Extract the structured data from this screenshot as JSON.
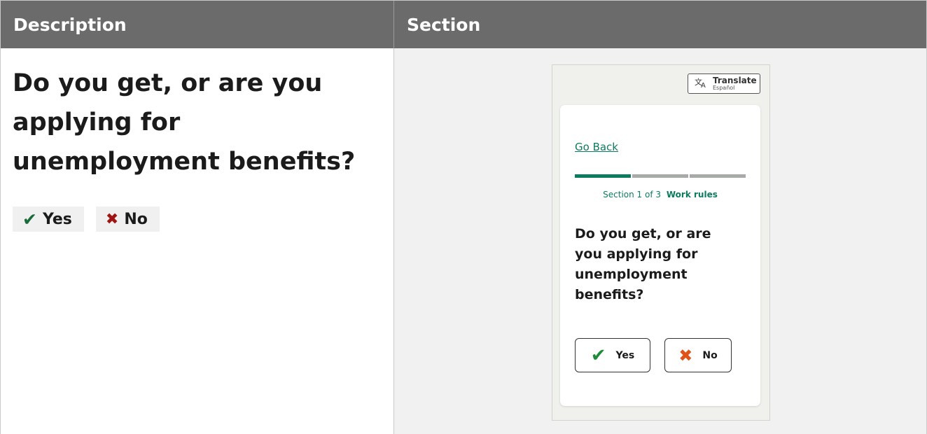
{
  "table": {
    "headers": [
      "Description",
      "Section"
    ]
  },
  "description": {
    "title": "Do you get, or are you applying for unemployment benefits?",
    "yes_label": "Yes",
    "no_label": "No",
    "yes_icon": "heavy-check-icon",
    "no_icon": "heavy-x-icon"
  },
  "preview": {
    "translate": {
      "label": "Translate",
      "sub_label": "Español",
      "icon": "translate-icon"
    },
    "go_back": "Go Back",
    "progress": {
      "current": 1,
      "total": 3
    },
    "section_text": "Section 1 of 3",
    "section_name": "Work rules",
    "question": "Do you get, or are you applying for unemployment benefits?",
    "yes_label": "Yes",
    "no_label": "No"
  },
  "colors": {
    "header_bg": "#6b6b6b",
    "accent_green": "#0c7c5e",
    "yes_green": "#1f8b3a",
    "no_orange": "#e05218",
    "no_dark_red": "#a01414"
  }
}
